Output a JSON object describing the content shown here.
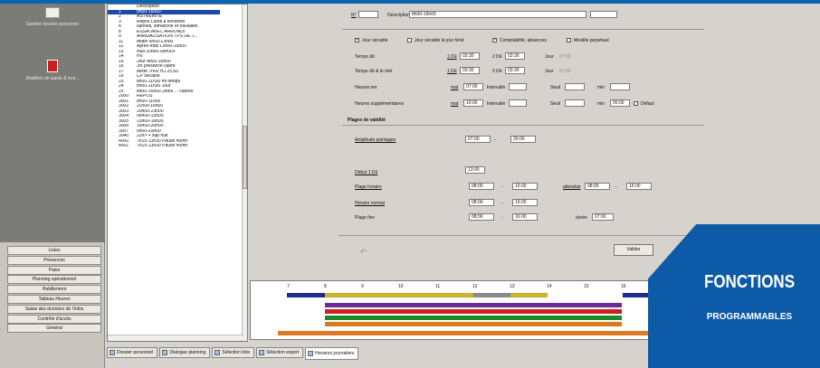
{
  "nav": {
    "tile1_label": "Gestion dossier personnel",
    "tile2_label": "Modèles de saisie & mot...",
    "items": [
      "Listes",
      "Présences",
      "Paies",
      "Planning opérationnel",
      "Habillement",
      "Tableau Heures",
      "Saisie des données de l'infos",
      "Contrôle d'accès",
      "Général"
    ]
  },
  "list": {
    "header": "Description",
    "items": [
      {
        "code": "1",
        "label": "8h00-16h00"
      },
      {
        "code": "2",
        "label": "ASTREINTE"
      },
      {
        "code": "3",
        "label": "Repos Lundi à vendredi"
      },
      {
        "code": "4",
        "label": "samedi, dimanche et travaillés"
      },
      {
        "code": "8",
        "label": "ESSAI AVEC ARRONDI"
      },
      {
        "code": "9",
        "label": "ANNUALISATION TPS DE T..."
      },
      {
        "code": "11",
        "label": "Matin 6h00-13h00"
      },
      {
        "code": "12",
        "label": "Après-midi 13h00-20h00"
      },
      {
        "code": "13",
        "label": "Nuit 20h00-06h00+"
      },
      {
        "code": "14",
        "label": "HV"
      },
      {
        "code": "15",
        "label": "Jour 8h00-16h00"
      },
      {
        "code": "16",
        "label": "Jrs présence cadre"
      },
      {
        "code": "17",
        "label": "Mixte 7h00 HJ 25,50"
      },
      {
        "code": "19",
        "label": "CP sécable"
      },
      {
        "code": "23",
        "label": "8h00-11h30 mi temps"
      },
      {
        "code": "24",
        "label": "8h00-11h30 Jour"
      },
      {
        "code": "25",
        "label": "8h00-16h00 Jours ... cadres"
      },
      {
        "code": "2000",
        "label": "REPOS"
      },
      {
        "code": "3001",
        "label": "8h00-11h00"
      },
      {
        "code": "3002",
        "label": "11h00-16h00"
      },
      {
        "code": "3003",
        "label": "20h00-23h00"
      },
      {
        "code": "3004",
        "label": "06h00-13h00"
      },
      {
        "code": "3005",
        "label": "13h00-16h00"
      },
      {
        "code": "3006",
        "label": "16h00-20h00"
      },
      {
        "code": "3007",
        "label": "6h00-20h00"
      },
      {
        "code": "3040",
        "label": "22h> + sup nuit"
      },
      {
        "code": "4000",
        "label": "7h15-13h30 Pause 45mn"
      },
      {
        "code": "4001",
        "label": "7h15-13h30 Pause 45mn"
      }
    ]
  },
  "form": {
    "code_label": "N°",
    "desc_label": "Description",
    "desc_value": "8h00-16h00",
    "chk_jour_secable": "Jour sécable",
    "chk_jour_secable_ferie": "Jour sécable le jour férié",
    "chk_comptabilite": "Comptabilité, absences",
    "chk_modele_perpetuel": "Modèle perpétuel",
    "temps_du_label": "Temps dû",
    "temps_du_reel_label": "Temps dû & le réel",
    "heures_net_label": "Heures net",
    "heures_supp_label": "Heures supplémentaires",
    "link1": "1 Dû",
    "link2": "2 Dû",
    "jour_label": "Jour",
    "d1": "03:30",
    "d2": "03:30",
    "d3": "03:30",
    "d4": "03:30",
    "jour_val": "07:00",
    "mat_label": "mat",
    "intervalle_label": "Intervalle",
    "seuil_label": "Seuil",
    "min_label": "min",
    "heures_net_mat": "07:00",
    "heures_supp_mat": "10:00",
    "heures_supp_min": "00:00",
    "defaut_label": "Défaut",
    "plages_title": "Plages de validité",
    "amplitude_label": "Amplitude pointages",
    "amp_from": "07:00",
    "amp_to": "20:00",
    "debut_label": "Début 1 Dû",
    "debut_val": "13:00",
    "plage_horaire_label": "Plage horaire",
    "ph_from": "08:00",
    "ph_to": "16:00",
    "attendue_label": "attendue",
    "att_from": "08:00",
    "att_to": "16:00",
    "horaire_normal_label": "Horaire normal",
    "hn_from": "08:00",
    "hn_to": "16:00",
    "plage_fixe_label": "Plage fixe",
    "pf_from": "08:00",
    "pf_to": "16:00",
    "duree_label": "durée",
    "duree_val": "07:00",
    "valider_label": "Valider"
  },
  "timeline": {
    "ticks": [
      "7",
      "8",
      "9",
      "10",
      "11",
      "12",
      "13",
      "14",
      "15",
      "16"
    ],
    "bars": [
      {
        "color": "#1f2d8a"
      },
      {
        "color": "#c8b426"
      },
      {
        "color": "#8a8a8a"
      },
      {
        "color": "#1f2d8a"
      },
      {
        "color": "#6a2d96"
      },
      {
        "color": "#cc2020"
      },
      {
        "color": "#1b8a2a"
      },
      {
        "color": "#e07820"
      }
    ]
  },
  "tabs": [
    "Dossier personnel",
    "Dialogue planning",
    "Sélection liste",
    "Sélection export",
    "Horaires journaliers"
  ],
  "badge": {
    "title": "FONCTIONS",
    "subtitle": "PROGRAMMABLES",
    "color": "#0d5ba8"
  }
}
